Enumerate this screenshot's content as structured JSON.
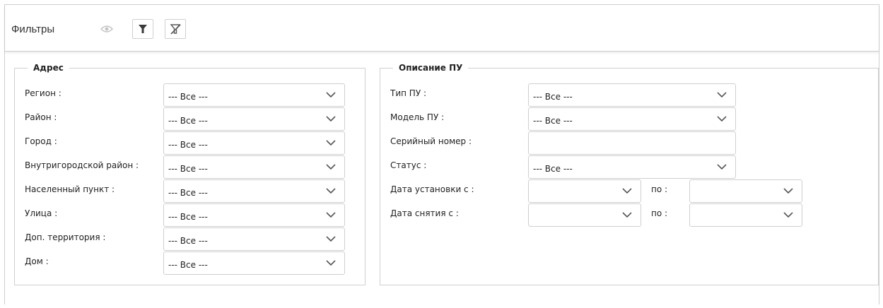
{
  "toolbar": {
    "title": "Фильтры",
    "buttons": [
      {
        "icon": "eye-icon",
        "disabled": true
      },
      {
        "icon": "filter-icon",
        "disabled": false
      },
      {
        "icon": "filter-clear-icon",
        "disabled": false
      }
    ]
  },
  "address": {
    "legend": "Адрес",
    "fields": [
      {
        "label": "Регион :",
        "value": "--- Все ---"
      },
      {
        "label": "Район :",
        "value": "--- Все ---"
      },
      {
        "label": "Город :",
        "value": "--- Все ---"
      },
      {
        "label": "Внутригородской район :",
        "value": "--- Все ---"
      },
      {
        "label": "Населенный пункт :",
        "value": "--- Все ---"
      },
      {
        "label": "Улица :",
        "value": "--- Все ---"
      },
      {
        "label": "Доп. территория :",
        "value": "--- Все ---"
      },
      {
        "label": "Дом :",
        "value": "--- Все ---"
      }
    ]
  },
  "device": {
    "legend": "Описание ПУ",
    "type": {
      "label": "Тип ПУ :",
      "value": "--- Все ---"
    },
    "model": {
      "label": "Модель ПУ :",
      "value": "--- Все ---"
    },
    "serial": {
      "label": "Серийный номер :",
      "value": ""
    },
    "status": {
      "label": "Статус :",
      "value": "--- Все ---"
    },
    "install_date": {
      "label": "Дата установки с :",
      "from": "",
      "to_label": "по :",
      "to": ""
    },
    "removal_date": {
      "label": "Дата снятия с :",
      "from": "",
      "to_label": "по :",
      "to": ""
    }
  },
  "colors": {
    "border": "#cfcfcf",
    "text": "#222222",
    "chevron": "#555555"
  }
}
